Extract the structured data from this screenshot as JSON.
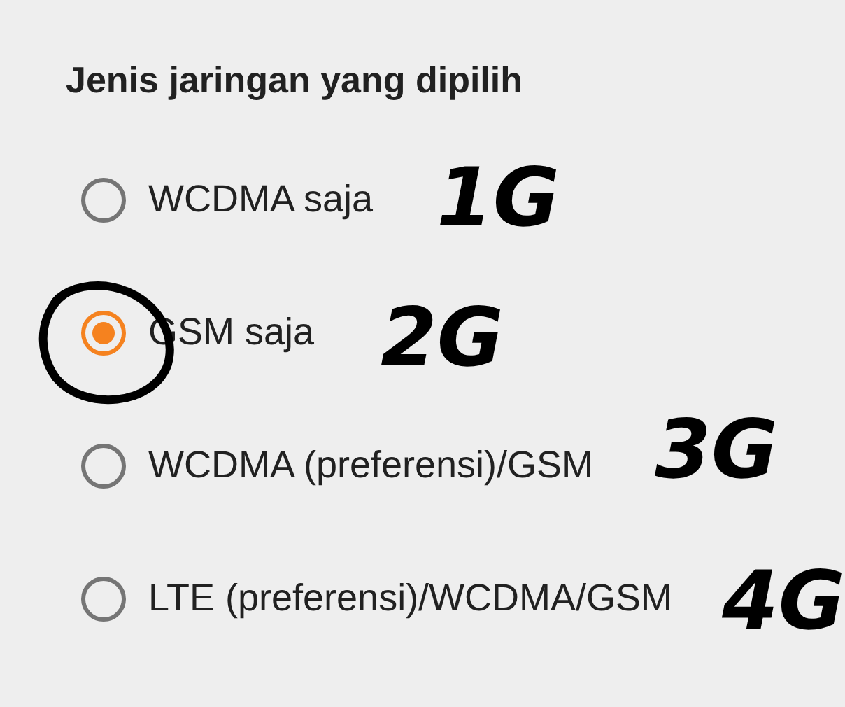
{
  "title": "Jenis jaringan yang dipilih",
  "options": [
    {
      "label": "WCDMA saja",
      "selected": false
    },
    {
      "label": "GSM saja",
      "selected": true
    },
    {
      "label": "WCDMA (preferensi)/GSM",
      "selected": false
    },
    {
      "label": "LTE (preferensi)/WCDMA/GSM",
      "selected": false
    }
  ],
  "annotations": [
    {
      "text": "1G"
    },
    {
      "text": "2G"
    },
    {
      "text": "3G"
    },
    {
      "text": "4G"
    }
  ]
}
